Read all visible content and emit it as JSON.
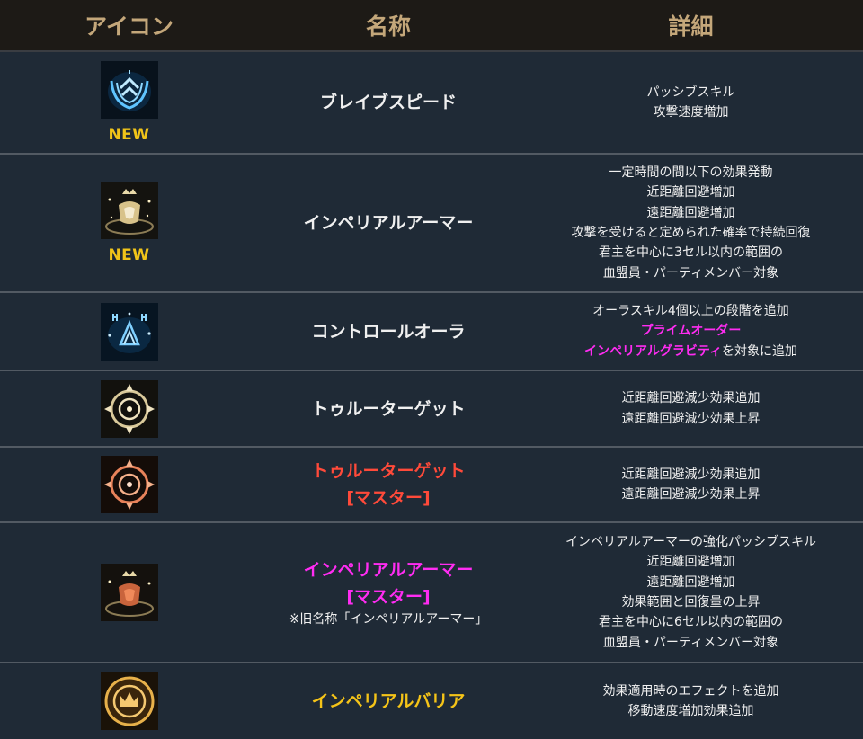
{
  "header": {
    "col_icon": "アイコン",
    "col_name": "名称",
    "col_detail": "詳細"
  },
  "rows": [
    {
      "icon": "brave-speed-icon",
      "badge": "NEW",
      "name": "ブレイブスピード",
      "details": [
        "パッシブスキル",
        "攻撃速度増加"
      ]
    },
    {
      "icon": "imperial-armor-icon",
      "badge": "NEW",
      "name": "インペリアルアーマー",
      "details": [
        "一定時間の間以下の効果発動",
        "近距離回避増加",
        "遠距離回避増加",
        "攻撃を受けると定められた確率で持続回復",
        "君主を中心に3セル以内の範囲の",
        "血盟員・パーティメンバー対象"
      ]
    },
    {
      "icon": "control-aura-icon",
      "name": "コントロールオーラ",
      "details": [
        "オーラスキル4個以上の段階を追加"
      ],
      "highlight1": "プライムオーダー",
      "highlight2": "インペリアルグラビティ",
      "suffix2": "を対象に追加"
    },
    {
      "icon": "true-target-icon",
      "name": "トゥルーターゲット",
      "details": [
        "近距離回避減少効果追加",
        "遠距離回避減少効果上昇"
      ]
    },
    {
      "icon": "true-target-master-icon",
      "name": "トゥルーターゲット",
      "name2": "[マスター]",
      "details": [
        "近距離回避減少効果追加",
        "遠距離回避減少効果上昇"
      ]
    },
    {
      "icon": "imperial-armor-master-icon",
      "name": "インペリアルアーマー",
      "name2": "[マスター]",
      "note": "※旧名称「インペリアルアーマー」",
      "details": [
        "インペリアルアーマーの強化パッシブスキル",
        "近距離回避増加",
        "遠距離回避増加",
        "効果範囲と回復量の上昇",
        "君主を中心に6セル以内の範囲の",
        "血盟員・パーティメンバー対象"
      ]
    },
    {
      "icon": "imperial-barrier-icon",
      "name": "インペリアルバリア",
      "details": [
        "効果適用時のエフェクトを追加",
        "移動速度増加効果追加"
      ]
    }
  ]
}
